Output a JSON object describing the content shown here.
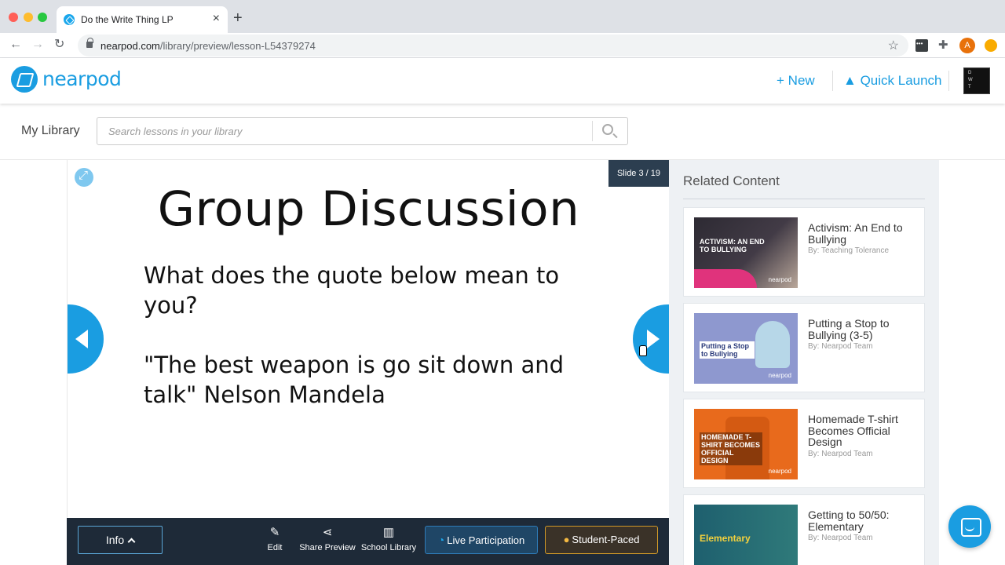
{
  "browser": {
    "tab_title": "Do the Write Thing LP",
    "tab_close": "×",
    "new_tab": "+",
    "url_domain": "nearpod.com",
    "url_path": "/library/preview/lesson-L54379274",
    "profile_initial": "A"
  },
  "header": {
    "logo_text": "nearpod",
    "new_label": "New",
    "quick_launch_label": "Quick Launch"
  },
  "library": {
    "title": "My Library",
    "search_placeholder": "Search lessons in your library"
  },
  "slide": {
    "counter": "Slide 3 / 19",
    "heading": "Group Discussion",
    "question": "What does the quote below mean to you?",
    "quote": "\"The best weapon is go sit down and talk\" Nelson Mandela"
  },
  "toolbar": {
    "info_label": "Info",
    "edit_label": "Edit",
    "share_label": "Share Preview",
    "school_library_label": "School Library",
    "live_label": "Live Participation",
    "student_paced_label": "Student-Paced"
  },
  "related": {
    "title": "Related Content",
    "items": [
      {
        "title": "Activism: An End to Bullying",
        "author": "By: Teaching Tolerance",
        "thumb_text": "ACTIVISM: AN END TO BULLYING"
      },
      {
        "title": "Putting a Stop to Bullying (3-5)",
        "author": "By: Nearpod Team",
        "thumb_text": "Putting a Stop to Bullying"
      },
      {
        "title": "Homemade T-shirt Becomes Official Design",
        "author": "By: Nearpod Team",
        "thumb_text": "HOMEMADE T-SHIRT BECOMES OFFICIAL DESIGN"
      },
      {
        "title": "Getting to 50/50: Elementary",
        "author": "By: Nearpod Team",
        "thumb_text": "Elementary"
      }
    ]
  },
  "colors": {
    "brand_blue": "#1a9de1",
    "toolbar_dark": "#1e2a38",
    "student_paced_border": "#d19a28"
  }
}
